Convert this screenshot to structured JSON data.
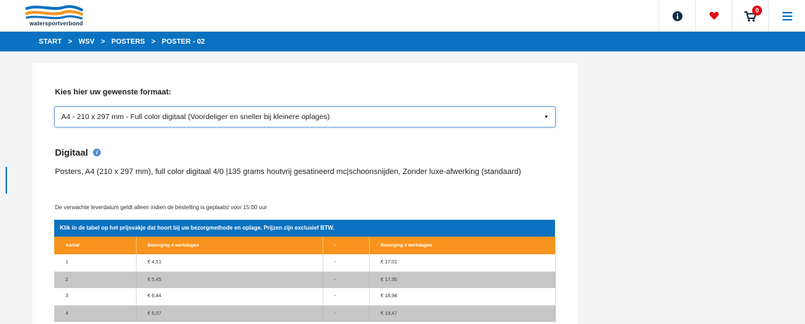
{
  "header": {
    "logo_text": "watersportverbond",
    "icons": [
      "info-icon",
      "heart-icon",
      "cart-icon",
      "menu-icon"
    ],
    "cart_count": "0"
  },
  "breadcrumb": {
    "items": [
      "START",
      "WSV",
      "POSTERS",
      "POSTER - 02"
    ],
    "separator": ">"
  },
  "product": {
    "format_label": "Kies hier uw gewenste formaat:",
    "format_selected": "A4 - 210 x 297 mm - Full color digitaal (Voordeliger en sneller bij kleinere oplages)",
    "section_title": "Digitaal",
    "description": "Posters, A4 (210 x 297 mm), full color digitaal 4/0 |135 grams houtvrij gesatineerd mc|schoonsnijden, Zonder luxe-afwerking (standaard)",
    "delivery_note": "De verwachte leverdatum geldt alleen indien de bestelling is geplaatst voor 15:00 uur"
  },
  "price_table": {
    "caption": "Klik in de tabel op het prijsvakje dat hoort bij uw bezorgmethode en oplage. Prijzen zijn exclusief BTW.",
    "headers": [
      "Aantal",
      "Bezorging 4 werkdagen",
      "-",
      "Bezorging 2 werkdagen"
    ],
    "rows": [
      [
        "1",
        "€ 4,51",
        "-",
        "€ 17,01"
      ],
      [
        "2",
        "€ 5,45",
        "-",
        "€ 17,95"
      ],
      [
        "3",
        "€ 6,44",
        "-",
        "€ 18,94"
      ],
      [
        "4",
        "€ 6,97",
        "-",
        "€ 19,47"
      ]
    ]
  },
  "colors": {
    "brand_blue": "#0a72c0",
    "header_orange": "#f7941d",
    "accent_red": "#e30613"
  }
}
